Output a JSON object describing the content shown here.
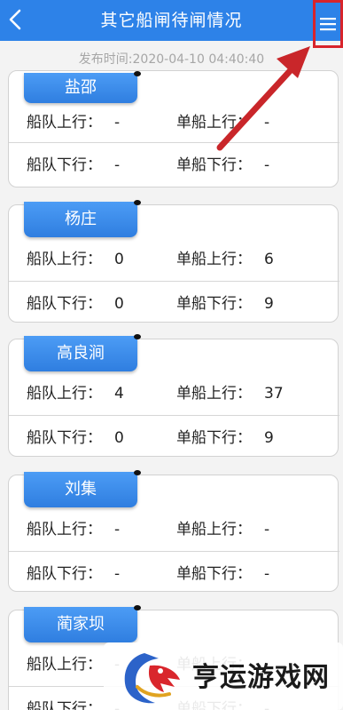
{
  "header": {
    "title": "其它船闸待闸情况",
    "back_icon": "chevron-left-icon",
    "menu_icon": "hamburger-menu-icon"
  },
  "publish_time": "发布时间:2020-04-10 04:40:40",
  "labels": {
    "fleet_up": "船队上行：",
    "fleet_down": "船队下行：",
    "single_up": "单船上行：",
    "single_down": "单船下行："
  },
  "locks": [
    {
      "name": "盐邵",
      "fleet_up": "-",
      "single_up": "-",
      "fleet_down": "-",
      "single_down": "-"
    },
    {
      "name": "杨庄",
      "fleet_up": "0",
      "single_up": "6",
      "fleet_down": "0",
      "single_down": "9"
    },
    {
      "name": "高良涧",
      "fleet_up": "4",
      "single_up": "37",
      "fleet_down": "0",
      "single_down": "9"
    },
    {
      "name": "刘集",
      "fleet_up": "-",
      "single_up": "-",
      "fleet_down": "-",
      "single_down": "-"
    },
    {
      "name": "蔺家坝",
      "fleet_up": "-",
      "single_up": "-",
      "fleet_down": "-",
      "single_down": "-"
    }
  ],
  "watermark": {
    "text": "亨运游戏网",
    "logo_icon": "dragon-logo"
  },
  "colors": {
    "header": "#2d82e8",
    "tag": "#3b8cee",
    "highlight": "#d8242b"
  }
}
